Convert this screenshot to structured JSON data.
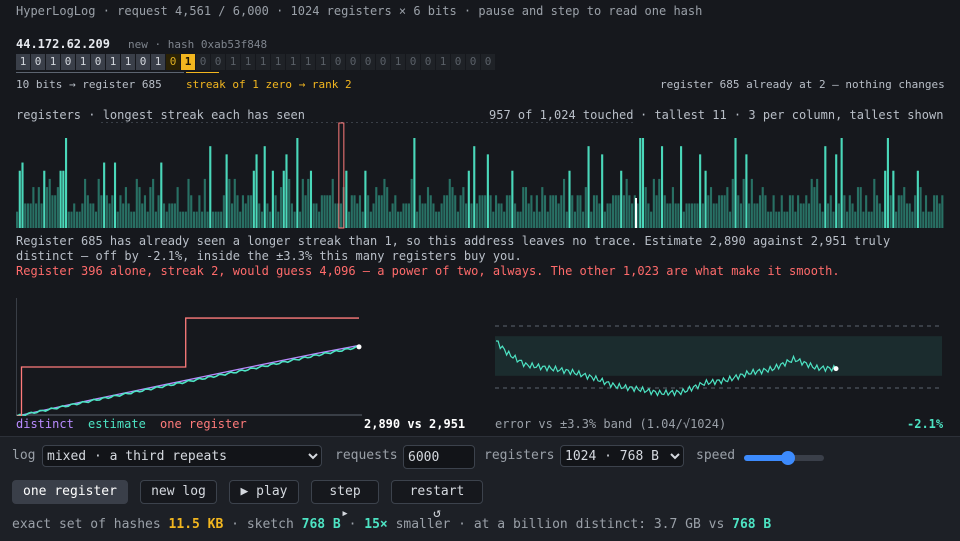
{
  "header": "HyperLogLog · request 4,561 / 6,000 · 1024 registers × 6 bits · pause and step to read one hash",
  "hash": {
    "ip": "44.172.62.209",
    "meta": "new · hash 0xab53f848",
    "bits": [
      "1",
      "0",
      "1",
      "0",
      "1",
      "0",
      "1",
      "1",
      "0",
      "1",
      "0",
      "1",
      "0",
      "0",
      "1",
      "1",
      "1",
      "1",
      "1",
      "1",
      "1",
      "0",
      "0",
      "0",
      "0",
      "1",
      "0",
      "0",
      "1",
      "0",
      "0",
      "0"
    ],
    "bits_label": "10 bits → register 685",
    "streak_label": "streak of 1 zero → rank 2",
    "register_note": "register 685 already at 2 — nothing changes"
  },
  "registers": {
    "title": "registers · longest streak each has seen",
    "touched": "957 of 1,024 touched",
    "tallest": "· tallest 11 · 3 per column, tallest shown",
    "max_rank": 11,
    "highlight_column": 119
  },
  "message": {
    "line1": "Register 685 has already seen a longer streak than 1, so this address leaves no trace. Estimate 2,890 against 2,951 truly distinct — off by -2.1%, inside the ±3.3% this many registers buy you.",
    "line2": "Register 396 alone, streak 2, would guess 4,096 — a power of two, always. The other 1,023 are what make it smooth."
  },
  "chart_data": [
    {
      "type": "line",
      "title": "",
      "series": [
        {
          "name": "distinct",
          "color": "#b98bff",
          "x": [
            0,
            1000,
            2000,
            3000,
            4000,
            4561
          ],
          "y": [
            0,
            680,
            1330,
            1980,
            2620,
            2951
          ]
        },
        {
          "name": "estimate",
          "color": "#4de3c3",
          "x": [
            0,
            1000,
            2000,
            3000,
            4000,
            4561
          ],
          "y": [
            0,
            640,
            1270,
            1890,
            2540,
            2890
          ]
        },
        {
          "name": "one register",
          "color": "#ff7b7b",
          "x": [
            0,
            60,
            60,
            2250,
            2250,
            4561
          ],
          "y": [
            0,
            0,
            2048,
            2048,
            4096,
            4096
          ]
        }
      ],
      "legend": [
        "distinct",
        "estimate",
        "one register"
      ],
      "value_label": "2,890 vs 2,951",
      "xlim": [
        0,
        4561
      ],
      "ylim": [
        0,
        4600
      ]
    },
    {
      "type": "line",
      "title": "error vs ±3.3% band (1.04/√1024)",
      "band": [
        -3.3,
        3.3
      ],
      "series": [
        {
          "name": "error",
          "color": "#4de3c3",
          "x": [
            0,
            150,
            400,
            700,
            1000,
            1300,
            1600,
            1900,
            2200,
            2500,
            2800,
            3100,
            3400,
            3700,
            4000,
            4300,
            4561
          ],
          "y": [
            2.5,
            0.5,
            -1.5,
            -2.0,
            -2.6,
            -3.6,
            -5.0,
            -5.5,
            -6.2,
            -6.0,
            -4.5,
            -4.0,
            -2.8,
            -2.2,
            -0.5,
            -2.0,
            -2.1
          ]
        }
      ],
      "value_label": "-2.1%",
      "xlim": [
        0,
        4561
      ],
      "ylim": [
        -8,
        6
      ]
    }
  ],
  "controls": {
    "log_label": "log",
    "log_value": "mixed · a third repeats",
    "requests_label": "requests",
    "requests_value": "6000",
    "registers_label": "registers",
    "registers_value": "1024 · 768 B",
    "speed_label": "speed",
    "speed_level": 0.55,
    "buttons": [
      "one register",
      "new log",
      "▶ play",
      "step ▸",
      "restart ↺"
    ]
  },
  "footer": {
    "p1": "exact set of hashes",
    "exact": "11.5 KB",
    "p2": "· sketch",
    "sketch": "768 B",
    "p3": "·",
    "ratio": "15×",
    "p4": "smaller · at a billion distinct: 3.7 GB vs",
    "billion": "768 B"
  },
  "colors": {
    "accent": "#4de3c3",
    "warn": "#f2b61f",
    "error": "#ff6b6b",
    "distinct": "#b98bff"
  }
}
